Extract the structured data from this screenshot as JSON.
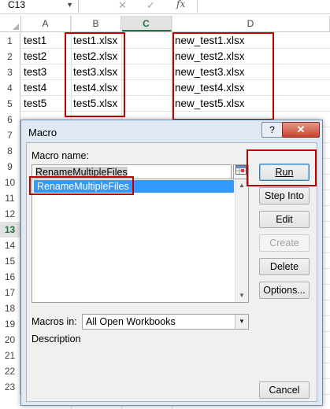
{
  "formula_bar": {
    "name_box": "C13",
    "cancel_symbol": "✕",
    "enter_symbol": "✓",
    "fx_label": "fx"
  },
  "columns": [
    "A",
    "B",
    "C",
    "D"
  ],
  "rows": [
    "1",
    "2",
    "3",
    "4",
    "5",
    "6",
    "7",
    "8",
    "9",
    "10",
    "11",
    "12",
    "13",
    "14",
    "15",
    "16",
    "17",
    "18",
    "19",
    "20",
    "21",
    "22",
    "23"
  ],
  "active_cell": {
    "column": "C",
    "row": "13"
  },
  "cells": {
    "A": [
      "test1",
      "test2",
      "test3",
      "test4",
      "test5"
    ],
    "B": [
      "test1.xlsx",
      "test2.xlsx",
      "test3.xlsx",
      "test4.xlsx",
      "test5.xlsx"
    ],
    "D": [
      "new_test1.xlsx",
      "new_test2.xlsx",
      "new_test3.xlsx",
      "new_test4.xlsx",
      "new_test5.xlsx"
    ]
  },
  "dialog": {
    "title": "Macro",
    "help_symbol": "?",
    "close_symbol": "✕",
    "macro_name_label": "Macro name:",
    "macro_name_value": "RenameMultipleFiles",
    "macros": [
      "RenameMultipleFiles"
    ],
    "buttons": {
      "run": "Run",
      "step_into": "Step Into",
      "edit": "Edit",
      "create": "Create",
      "delete": "Delete",
      "options": "Options...",
      "cancel": "Cancel"
    },
    "macros_in_label": "Macros in:",
    "macros_in_value": "All Open Workbooks",
    "description_label": "Description"
  },
  "colors": {
    "highlight_border": "#c00000",
    "selection": "#3399ff",
    "excel_green": "#217346"
  },
  "icons": [
    "ref-edit-icon",
    "scroll-up-arrow-icon",
    "scroll-down-arrow-icon",
    "dropdown-arrow-icon"
  ]
}
